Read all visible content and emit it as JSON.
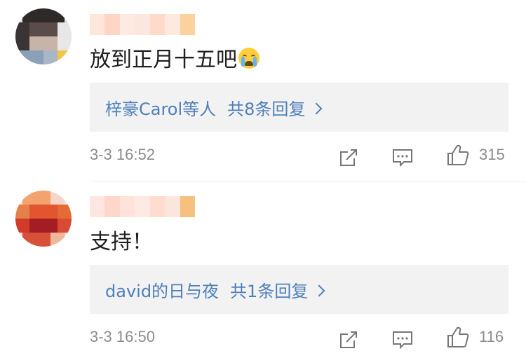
{
  "comments": [
    {
      "text": "放到正月十五吧",
      "emoji_icon": "crying-face-icon",
      "reply_summary": {
        "users": "梓豪Carol等人",
        "count_text": "共8条回复"
      },
      "timestamp": "3-3 16:52",
      "likes": "315"
    },
    {
      "text": "支持！",
      "reply_summary": {
        "users": "david的日与夜",
        "count_text": "共1条回复"
      },
      "timestamp": "3-3 16:50",
      "likes": "116"
    }
  ],
  "colors": {
    "link": "#4d7fbb",
    "meta": "#8c8c8c",
    "reply_bg": "#f2f2f2"
  },
  "icons": [
    "share-icon",
    "comment-icon",
    "like-icon",
    "chevron-right-icon"
  ]
}
